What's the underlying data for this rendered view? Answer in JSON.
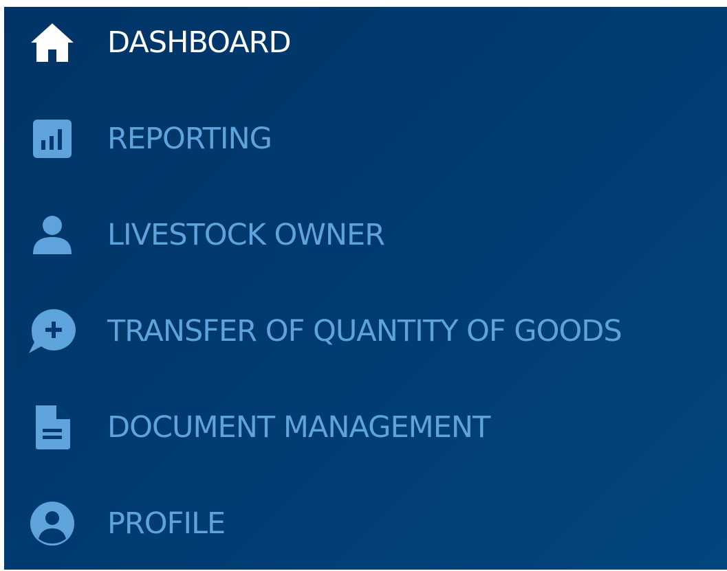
{
  "colors": {
    "active": "#ffffff",
    "inactive": "#5ea3dc",
    "background": "#013a70"
  },
  "nav": {
    "items": [
      {
        "label": "DASHBOARD",
        "icon": "home-icon",
        "active": true
      },
      {
        "label": "REPORTING",
        "icon": "bar-chart-icon",
        "active": false
      },
      {
        "label": "LIVESTOCK OWNER",
        "icon": "user-icon",
        "active": false
      },
      {
        "label": "TRANSFER OF QUANTITY OF GOODS",
        "icon": "chat-plus-icon",
        "active": false
      },
      {
        "label": "DOCUMENT MANAGEMENT",
        "icon": "document-icon",
        "active": false
      },
      {
        "label": "PROFILE",
        "icon": "user-circle-icon",
        "active": false
      }
    ]
  }
}
